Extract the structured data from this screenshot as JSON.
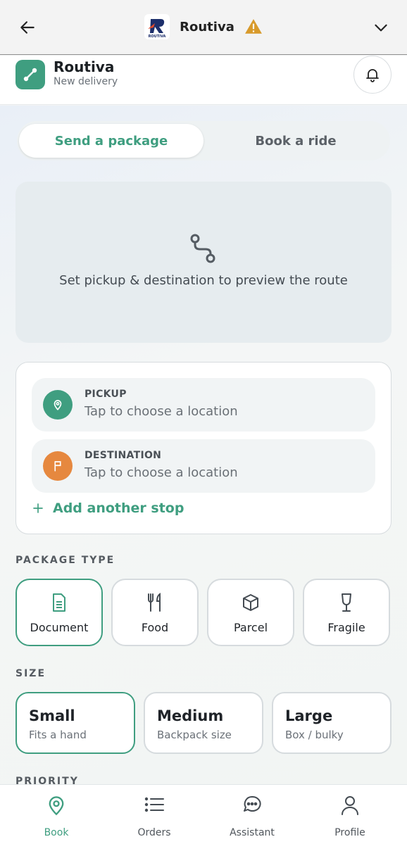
{
  "topbar": {
    "title": "Routiva",
    "logo_text": "ROUTIVA",
    "icons": {
      "back": "arrow-left-icon",
      "warning": "warning-icon",
      "menu": "chevron-down-icon"
    }
  },
  "header": {
    "app_name": "Routiva",
    "subtitle": "New delivery",
    "icons": {
      "brand": "route-icon",
      "notifications": "bell-icon"
    }
  },
  "tabs": [
    {
      "label": "Send a package",
      "active": true
    },
    {
      "label": "Book a ride",
      "active": false
    }
  ],
  "map_preview": {
    "message": "Set pickup & destination to preview the route",
    "icon": "route-icon"
  },
  "stops": {
    "pickup": {
      "label": "PICKUP",
      "value": "Tap to choose a location",
      "icon": "map-pin-icon",
      "color": "#3f9e80"
    },
    "destination": {
      "label": "DESTINATION",
      "value": "Tap to choose a location",
      "icon": "flag-icon",
      "color": "#e6883f"
    },
    "add_label": "Add another stop"
  },
  "package_type": {
    "section_label": "PACKAGE TYPE",
    "options": [
      {
        "label": "Document",
        "icon": "document-icon",
        "selected": true
      },
      {
        "label": "Food",
        "icon": "utensils-icon",
        "selected": false
      },
      {
        "label": "Parcel",
        "icon": "box-icon",
        "selected": false
      },
      {
        "label": "Fragile",
        "icon": "glass-icon",
        "selected": false
      }
    ]
  },
  "size": {
    "section_label": "SIZE",
    "options": [
      {
        "name": "Small",
        "desc": "Fits a hand",
        "selected": true
      },
      {
        "name": "Medium",
        "desc": "Backpack size",
        "selected": false
      },
      {
        "name": "Large",
        "desc": "Box / bulky",
        "selected": false
      }
    ]
  },
  "priority": {
    "section_label": "PRIORITY"
  },
  "nav": [
    {
      "label": "Book",
      "icon": "map-pin-icon",
      "active": true
    },
    {
      "label": "Orders",
      "icon": "list-icon",
      "active": false
    },
    {
      "label": "Assistant",
      "icon": "chat-icon",
      "active": false
    },
    {
      "label": "Profile",
      "icon": "user-icon",
      "active": false
    }
  ],
  "colors": {
    "accent": "#3f9e80",
    "destination": "#e6883f",
    "warning": "#d89a2b"
  }
}
